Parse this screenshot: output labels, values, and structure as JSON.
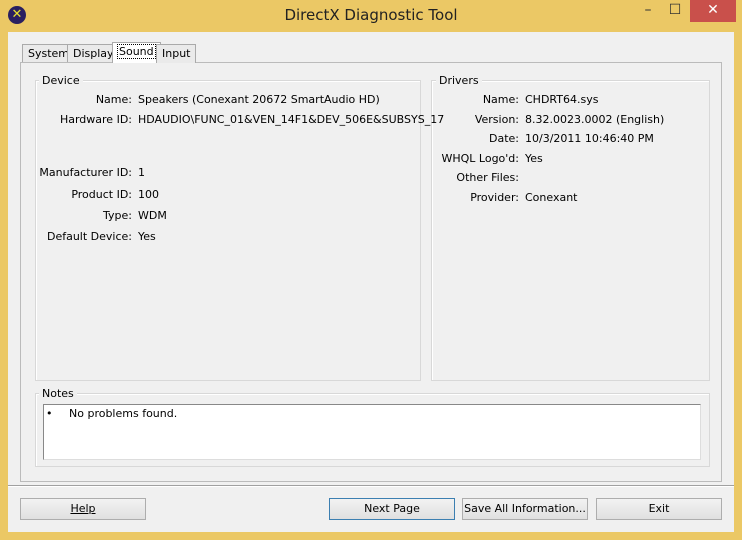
{
  "window": {
    "title": "DirectX Diagnostic Tool",
    "minimize": "–",
    "maximize": "☐",
    "close": "✕"
  },
  "tabs": [
    {
      "label": "System"
    },
    {
      "label": "Display"
    },
    {
      "label": "Sound",
      "active": true
    },
    {
      "label": "Input"
    }
  ],
  "device": {
    "title": "Device",
    "fields": [
      {
        "label": "Name:",
        "value": "Speakers (Conexant 20672 SmartAudio HD)"
      },
      {
        "label": "Hardware ID:",
        "value": "HDAUDIO\\FUNC_01&VEN_14F1&DEV_506E&SUBSYS_17"
      },
      {
        "label": "Manufacturer ID:",
        "value": "1"
      },
      {
        "label": "Product ID:",
        "value": "100"
      },
      {
        "label": "Type:",
        "value": "WDM"
      },
      {
        "label": "Default Device:",
        "value": "Yes"
      }
    ]
  },
  "drivers": {
    "title": "Drivers",
    "fields": [
      {
        "label": "Name:",
        "value": "CHDRT64.sys"
      },
      {
        "label": "Version:",
        "value": "8.32.0023.0002 (English)"
      },
      {
        "label": "Date:",
        "value": "10/3/2011 10:46:40 PM"
      },
      {
        "label": "WHQL Logo'd:",
        "value": "Yes"
      },
      {
        "label": "Other Files:",
        "value": ""
      },
      {
        "label": "Provider:",
        "value": "Conexant"
      }
    ]
  },
  "notes": {
    "title": "Notes",
    "bullet": "•",
    "items": [
      "No problems found."
    ]
  },
  "buttons": {
    "help": "Help",
    "next": "Next Page",
    "save": "Save All Information...",
    "exit": "Exit"
  }
}
